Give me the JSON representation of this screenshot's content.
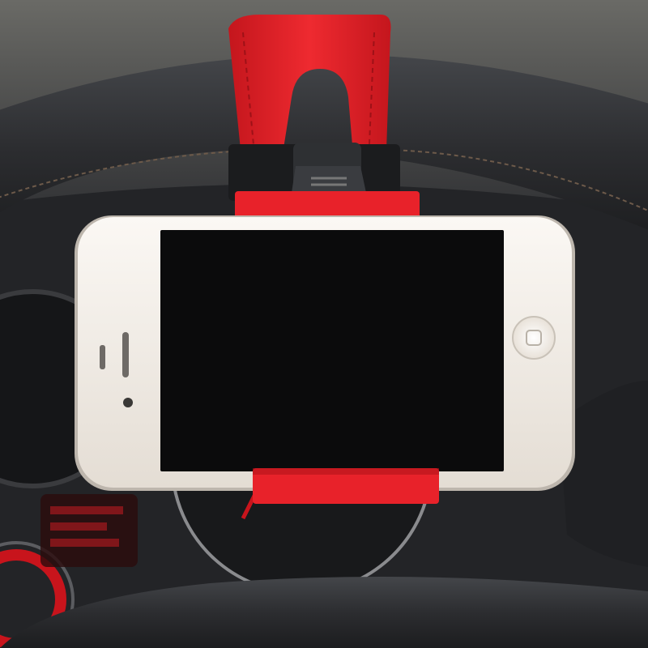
{
  "scene": {
    "subject": "smartphone-in-steering-wheel-mount",
    "colors": {
      "mount_red": "#e8222a",
      "mount_red_dark": "#b3141b",
      "wheel_leather": "#2c2d30",
      "phone_body": "#f1ece6",
      "phone_screen": "#0b0b0c",
      "dashboard": "#1d1e21",
      "gauge_red": "#c8141c"
    },
    "icons": [
      "home-button-icon",
      "earpiece-icon",
      "front-camera-icon",
      "mute-switch-icon"
    ]
  }
}
